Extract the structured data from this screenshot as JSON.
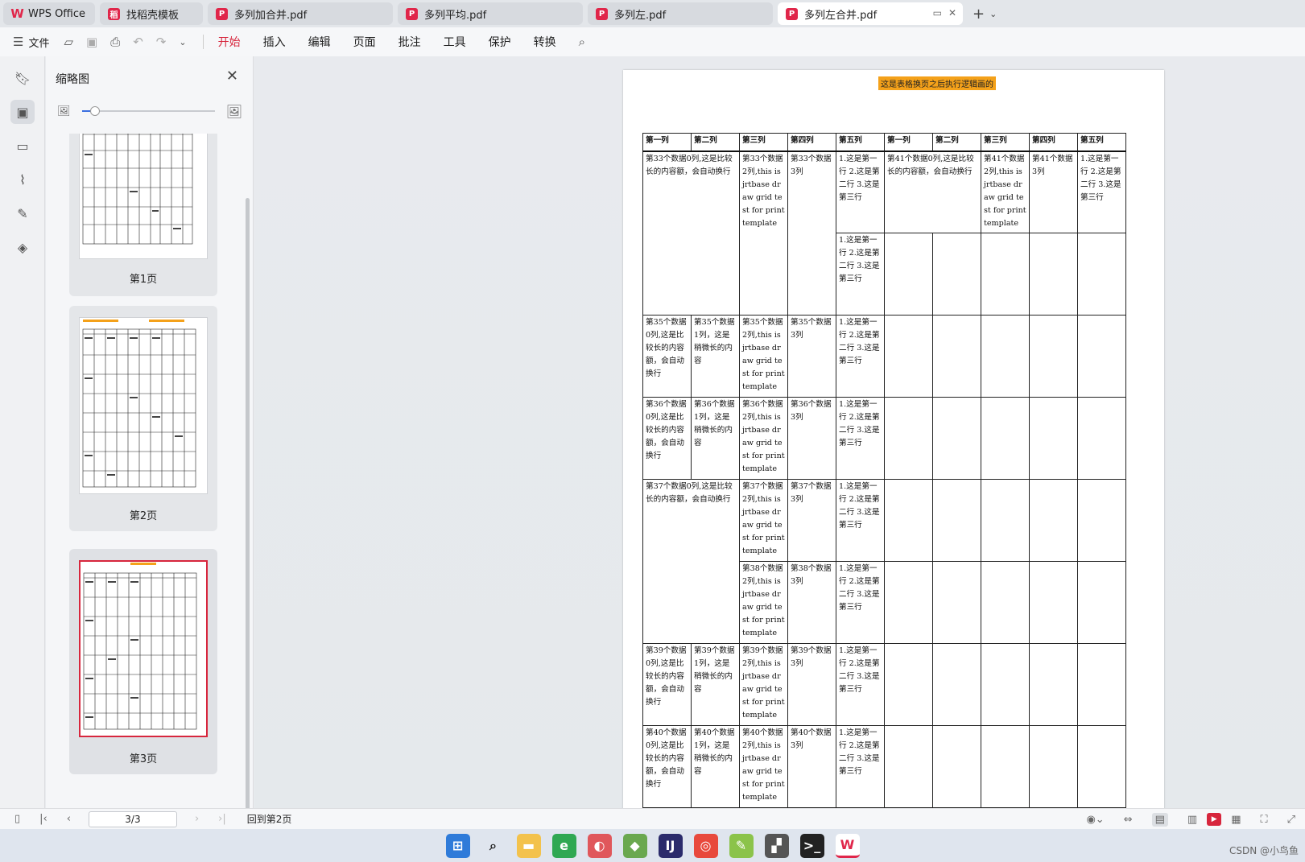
{
  "tabs": [
    {
      "label": "WPS Office",
      "type": "home"
    },
    {
      "label": "找稻壳模板",
      "type": "template"
    },
    {
      "label": "多列加合并.pdf",
      "type": "pdf"
    },
    {
      "label": "多列平均.pdf",
      "type": "pdf"
    },
    {
      "label": "多列左.pdf",
      "type": "pdf"
    },
    {
      "label": "多列左合并.pdf",
      "type": "pdf",
      "active": true
    }
  ],
  "toolbar": {
    "file_label": "文件",
    "menus": [
      "开始",
      "插入",
      "编辑",
      "页面",
      "批注",
      "工具",
      "保护",
      "转换"
    ],
    "active_menu": "开始"
  },
  "thumbnail_panel": {
    "title": "缩略图",
    "zoom_level": 0.1,
    "pages": [
      {
        "label": "第1页"
      },
      {
        "label": "第2页"
      },
      {
        "label": "第3页",
        "selected": true
      }
    ]
  },
  "document": {
    "title_text": "这是表格换页之后执行逻辑画的",
    "header": [
      "第一列",
      "第二列",
      "第三列",
      "第四列",
      "第五列",
      "第一列",
      "第二列",
      "第三列",
      "第四列",
      "第五列"
    ],
    "cells": {
      "r33_c0": "第33个数据0列,这是比较长的内容额，会自动换行",
      "r33_c2": "第33个数据2列,this is jrtbase draw grid test for printtemplate",
      "r33_c3": "第33个数据3列",
      "lines_123": "1.这是第一行 2.这是第二行 3.这是第三行",
      "r41_c0": "第41个数据0列,这是比较长的内容额，会自动换行",
      "r41_c2": "第41个数据2列,this is jrtbase draw grid test for printtemplate",
      "r41_c3": "第41个数据3列",
      "r35_c0": "第35个数据0列,这是比较长的内容额，会自动换行",
      "r35_c1": "第35个数据1列，这是稍微长的内容",
      "r35_c2": "第35个数据2列,this is jrtbase draw grid test for printtemplate",
      "r35_c3": "第35个数据3列",
      "r36_c0": "第36个数据0列,这是比较长的内容额，会自动换行",
      "r36_c1": "第36个数据1列，这是稍微长的内容",
      "r36_c2": "第36个数据2列,this is jrtbase draw grid test for printtemplate",
      "r36_c3": "第36个数据3列",
      "r37_c0": "第37个数据0列,这是比较长的内容额，会自动换行",
      "r37_c2": "第37个数据2列,this is jrtbase draw grid test for printtemplate",
      "r37_c3": "第37个数据3列",
      "r38_c2": "第38个数据2列,this is jrtbase draw grid test for printtemplate",
      "r38_c3": "第38个数据3列",
      "r39_c0": "第39个数据0列,这是比较长的内容额，会自动换行",
      "r39_c1": "第39个数据1列，这是稍微长的内容",
      "r39_c2": "第39个数据2列,this is jrtbase draw grid test for printtemplate",
      "r39_c3": "第39个数据3列",
      "r40_c0": "第40个数据0列,这是比较长的内容额，会自动换行",
      "r40_c1": "第40个数据1列，这是稍微长的内容",
      "r40_c2": "第40个数据2列,this is jrtbase draw grid test for printtemplate",
      "r40_c3": "第40个数据3列"
    }
  },
  "statusbar": {
    "page_input": "3/3",
    "back_label": "回到第2页"
  },
  "watermark": "CSDN @小鸟鱼",
  "colors": {
    "accent": "#d7263d",
    "highlight": "#f4a11a"
  }
}
